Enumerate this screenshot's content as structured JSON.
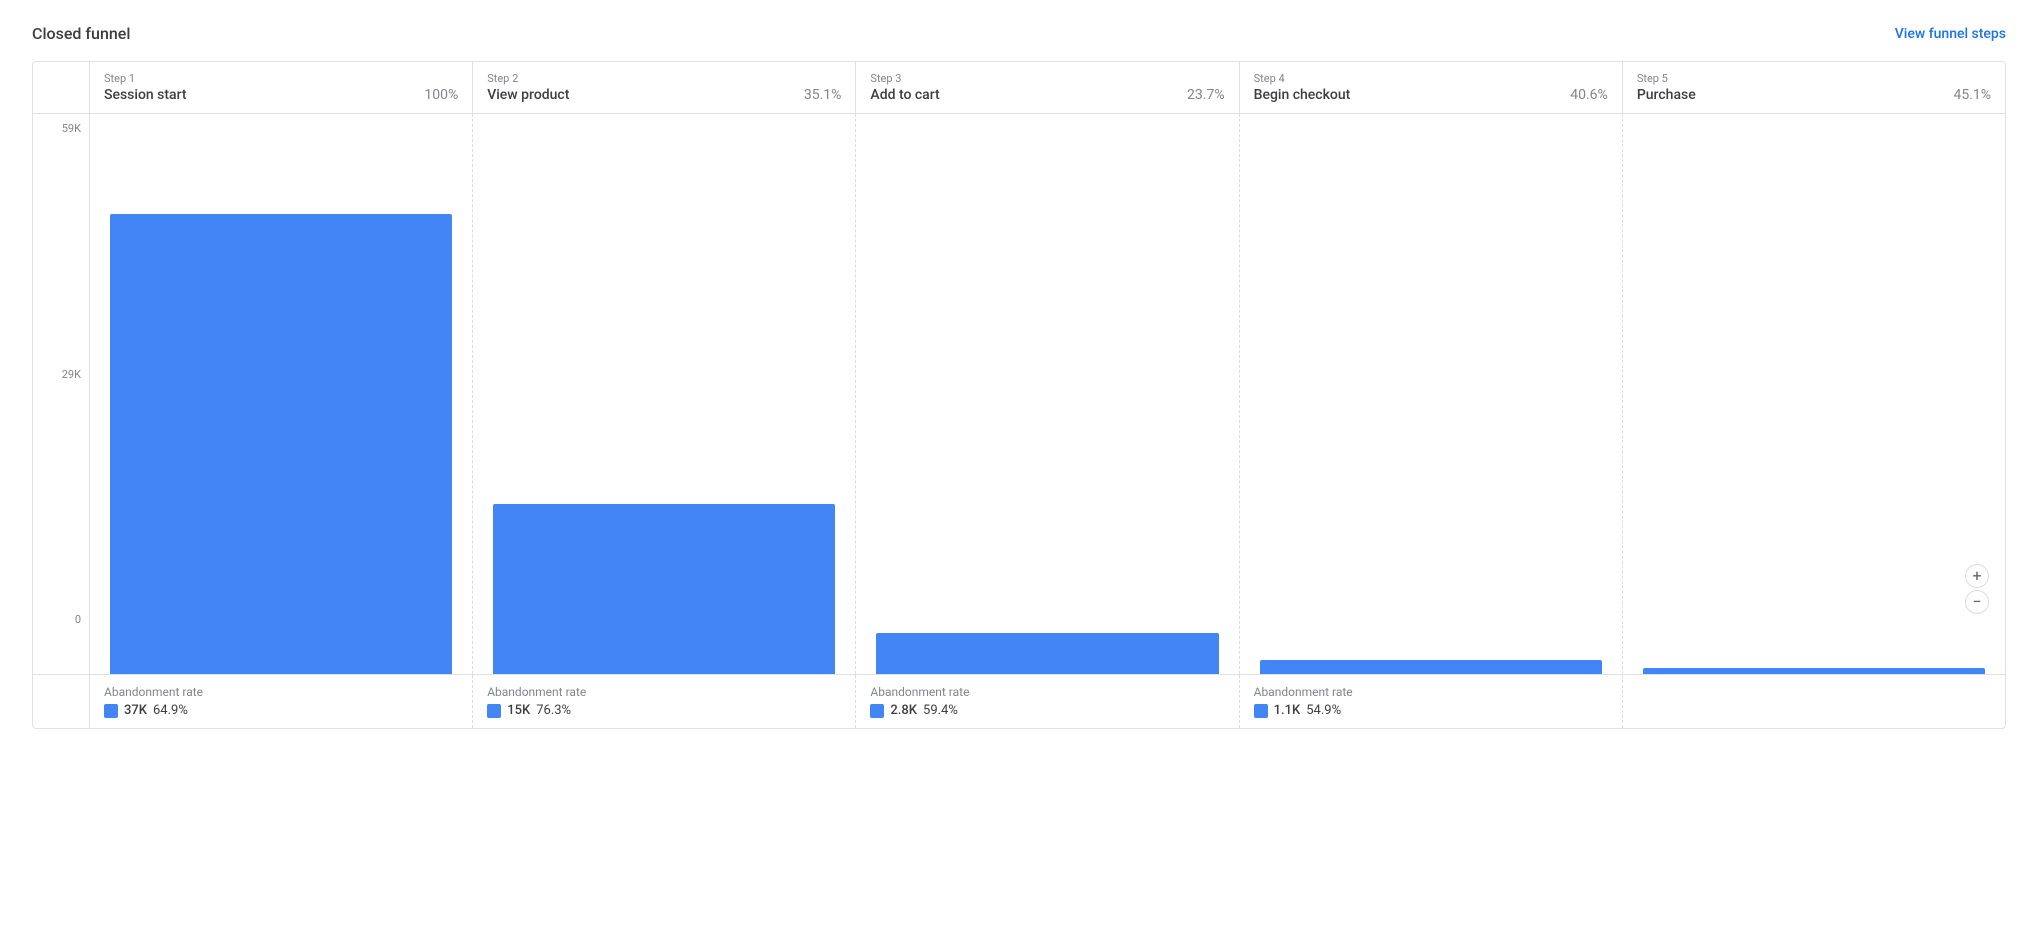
{
  "header": {
    "title": "Closed funnel",
    "view_funnel_label": "View funnel steps"
  },
  "y_axis": {
    "labels": [
      "59K",
      "29K",
      "0"
    ]
  },
  "steps": [
    {
      "label": "Step 1",
      "name": "Session start",
      "pct": "100%",
      "bar_height_pct": 100,
      "abandonment_label": "Abandonment rate",
      "abandonment_count": "37K",
      "abandonment_pct": "64.9%"
    },
    {
      "label": "Step 2",
      "name": "View product",
      "pct": "35.1%",
      "bar_height_pct": 37,
      "abandonment_label": "Abandonment rate",
      "abandonment_count": "15K",
      "abandonment_pct": "76.3%"
    },
    {
      "label": "Step 3",
      "name": "Add to cart",
      "pct": "23.7%",
      "bar_height_pct": 9,
      "abandonment_label": "Abandonment rate",
      "abandonment_count": "2.8K",
      "abandonment_pct": "59.4%"
    },
    {
      "label": "Step 4",
      "name": "Begin checkout",
      "pct": "40.6%",
      "bar_height_pct": 3,
      "abandonment_label": "Abandonment rate",
      "abandonment_count": "1.1K",
      "abandonment_pct": "54.9%"
    },
    {
      "label": "Step 5",
      "name": "Purchase",
      "pct": "45.1%",
      "bar_height_pct": 1.2,
      "abandonment_label": "",
      "abandonment_count": "",
      "abandonment_pct": ""
    }
  ],
  "zoom": {
    "plus": "+",
    "minus": "−"
  }
}
